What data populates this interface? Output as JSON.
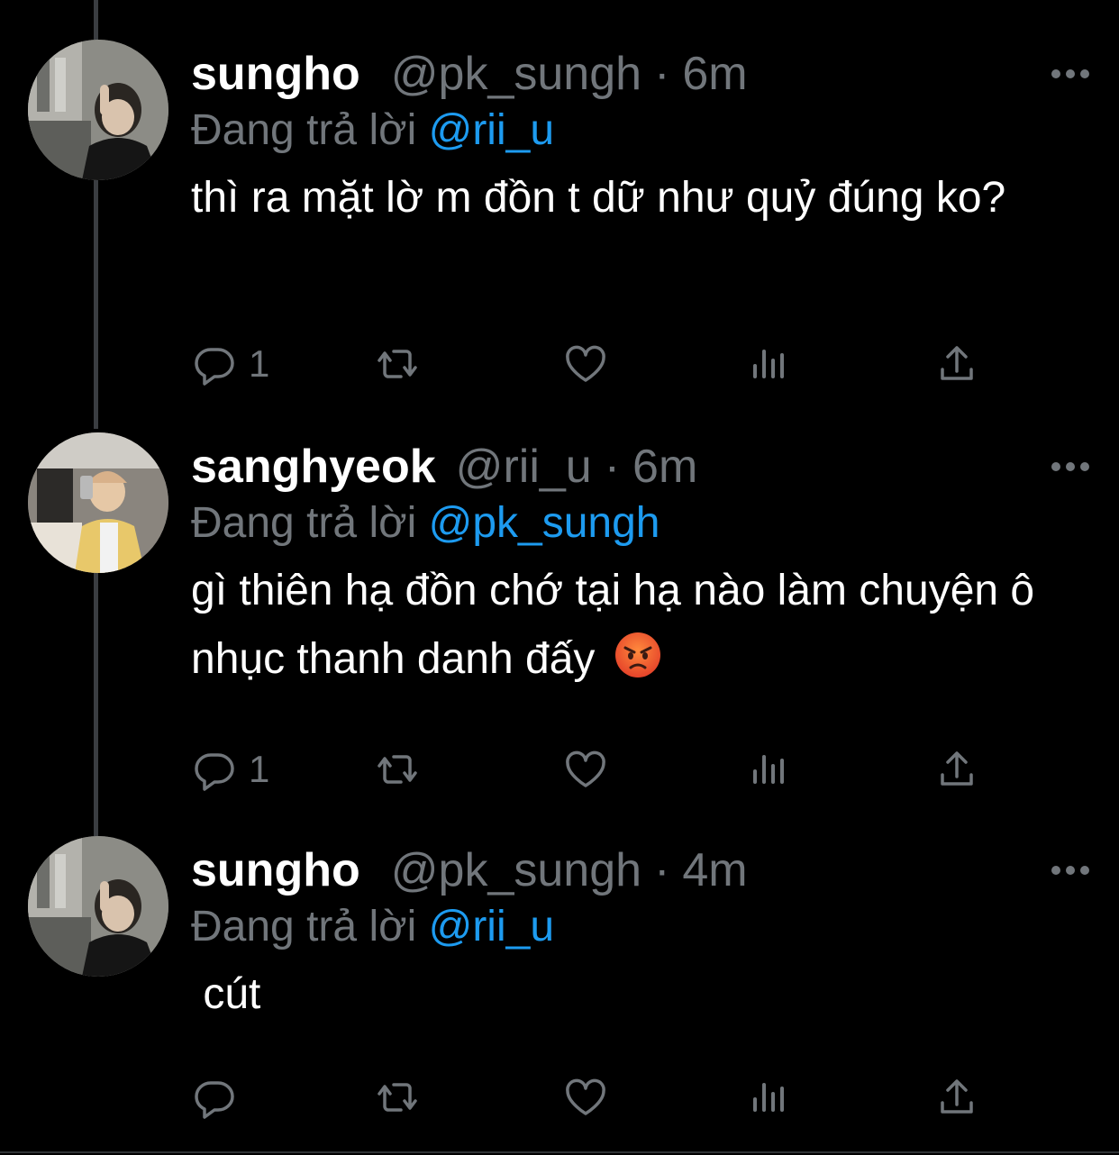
{
  "tweets": [
    {
      "name": "sungho",
      "handle": "@pk_sungh",
      "dot": "·",
      "time": "6m",
      "replying_prefix": "Đang trả lời",
      "replying_to": "@rii_u",
      "text": "thì ra mặt lờ m đồn t dữ như quỷ đúng ko?",
      "reply_count": "1",
      "avatar_icon": "profile-photo"
    },
    {
      "name": "sanghyeok",
      "handle": "@rii_u",
      "dot": "·",
      "time": "6m",
      "replying_prefix": "Đang trả lời",
      "replying_to": "@pk_sungh",
      "text": "gì thiên hạ đồn chớ tại hạ nào làm chuyện ô nhục thanh danh đấy",
      "emoji": "angry-face",
      "reply_count": "1",
      "avatar_icon": "profile-photo"
    },
    {
      "name": "sungho",
      "handle": "@pk_sungh",
      "dot": "·",
      "time": "4m",
      "replying_prefix": "Đang trả lời",
      "replying_to": "@rii_u",
      "text": " cút",
      "reply_count": "",
      "avatar_icon": "profile-photo"
    }
  ],
  "colors": {
    "background": "#000000",
    "muted": "#71767b",
    "mention": "#1d9bf0",
    "text": "#ffffff"
  },
  "action_icons": [
    "reply-icon",
    "retweet-icon",
    "like-icon",
    "views-icon",
    "share-icon"
  ]
}
